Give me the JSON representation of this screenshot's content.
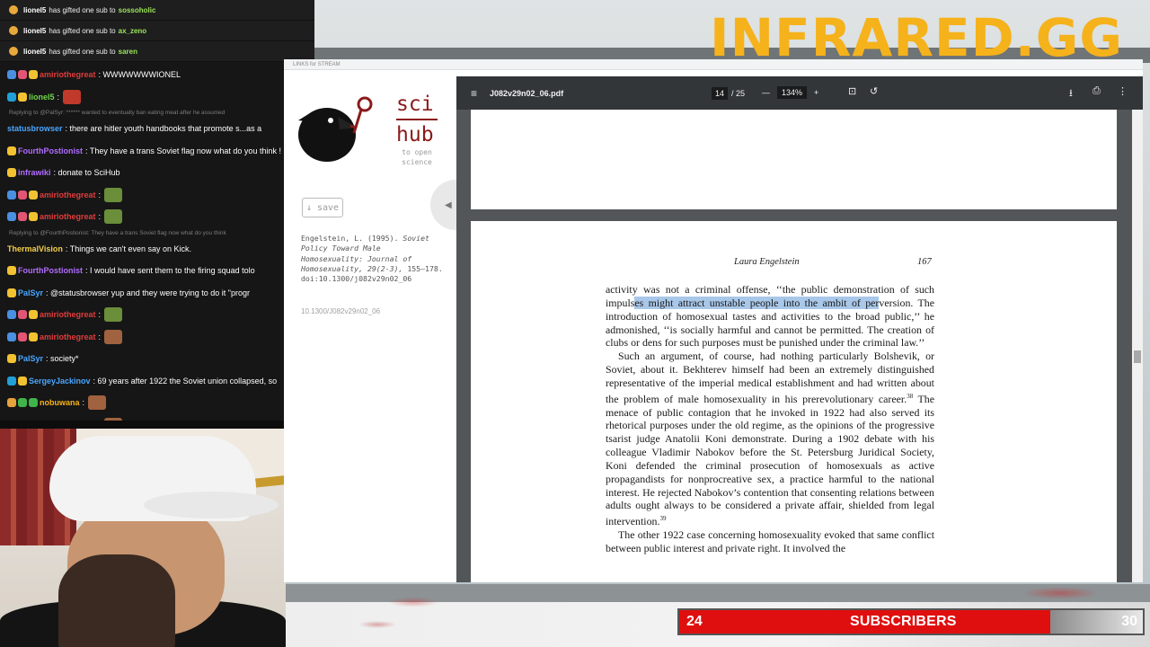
{
  "brand": "INFRARED.GG",
  "gift_subs": [
    {
      "gifter": "lionel5",
      "text": "has gifted one sub to",
      "recipient": "sossoholic"
    },
    {
      "gifter": "lionel5",
      "text": "has gifted one sub to",
      "recipient": "ax_zeno"
    },
    {
      "gifter": "lionel5",
      "text": "has gifted one sub to",
      "recipient": "saren"
    }
  ],
  "chat": [
    {
      "type": "msg",
      "user": "amiriothegreat",
      "user_color": "#e03c3c",
      "text": ": WWWWWWWIONEL",
      "badges": [
        "b-blue",
        "b-pink",
        "b-yel"
      ],
      "emote": ""
    },
    {
      "type": "msg",
      "user": "lionel5",
      "user_color": "#6fd64b",
      "text": ":",
      "badges": [
        "b-cyan",
        "b-yel"
      ],
      "emote": "red"
    },
    {
      "type": "reply",
      "text": "Replying to @PalSyr: ****** wanted to eventually ban eating meat after he assumed"
    },
    {
      "type": "msg",
      "user": "statusbrowser",
      "user_color": "#4aa6ff",
      "text": ": there are hitler youth handbooks that promote s...as a",
      "badges": [],
      "emote": ""
    },
    {
      "type": "msg",
      "user": "FourthPostionist",
      "user_color": "#b06cff",
      "text": ": They have a trans Soviet flag now what do you think !",
      "badges": [
        "b-yel"
      ],
      "emote": ""
    },
    {
      "type": "msg",
      "user": "infrawiki",
      "user_color": "#b06cff",
      "text": ": donate to SciHub",
      "badges": [
        "b-yel"
      ],
      "emote": ""
    },
    {
      "type": "msg",
      "user": "amiriothegreat",
      "user_color": "#e03c3c",
      "text": ":",
      "badges": [
        "b-blue",
        "b-pink",
        "b-yel"
      ],
      "emote": "green"
    },
    {
      "type": "msg",
      "user": "amiriothegreat",
      "user_color": "#e03c3c",
      "text": ":",
      "badges": [
        "b-blue",
        "b-pink",
        "b-yel"
      ],
      "emote": "green"
    },
    {
      "type": "reply",
      "text": "Replying to @FourthPostionist: They have a trans Soviet flag now what do you think"
    },
    {
      "type": "msg",
      "user": "ThermalVision",
      "user_color": "#f5d04a",
      "text": ": Things we can't even say on Kick.",
      "badges": [],
      "emote": ""
    },
    {
      "type": "msg",
      "user": "FourthPostionist",
      "user_color": "#b06cff",
      "text": ": I would have sent them to the firing squad tolo",
      "badges": [
        "b-yel"
      ],
      "emote": ""
    },
    {
      "type": "msg",
      "user": "PalSyr",
      "user_color": "#4aa6ff",
      "text": ": @statusbrowser yup and they were trying to do it \"progr",
      "badges": [
        "b-yel"
      ],
      "emote": ""
    },
    {
      "type": "msg",
      "user": "amiriothegreat",
      "user_color": "#e03c3c",
      "text": ":",
      "badges": [
        "b-blue",
        "b-pink",
        "b-yel"
      ],
      "emote": "green"
    },
    {
      "type": "msg",
      "user": "amiriothegreat",
      "user_color": "#e03c3c",
      "text": ":",
      "badges": [
        "b-blue",
        "b-pink",
        "b-yel"
      ],
      "emote": "face"
    },
    {
      "type": "msg",
      "user": "PalSyr",
      "user_color": "#4aa6ff",
      "text": ": society*",
      "badges": [
        "b-yel"
      ],
      "emote": ""
    },
    {
      "type": "msg",
      "user": "SergeyJackinov",
      "user_color": "#4aa6ff",
      "text": ": 69 years after 1922 the Soviet union collapsed, so",
      "badges": [
        "b-cyan",
        "b-yel"
      ],
      "emote": ""
    },
    {
      "type": "msg",
      "user": "nobuwana",
      "user_color": "#f5b21b",
      "text": ":",
      "badges": [
        "b-gold",
        "b-grn",
        "b-grn"
      ],
      "emote": "face"
    },
    {
      "type": "msg",
      "user": "amiriothegreat",
      "user_color": "#e03c3c",
      "text": ":",
      "badges": [
        "b-blue",
        "b-pink",
        "b-yel"
      ],
      "emote": "face"
    }
  ],
  "browser": {
    "tab_text": "LINKS for STREAM",
    "scihub": {
      "logo_line1": "sci",
      "logo_line2": "hub",
      "logo_sub": "to open science",
      "save_label": "↓ save",
      "citation_plain1": "Engelstein, L. (1995).",
      "citation_italic": "Soviet Policy Toward Male Homosexuality: Journal of Homosexuality, 29(2-3),",
      "citation_plain2": "155–178.",
      "citation_doi": "doi:10.1300/j082v29n02_06",
      "doi_short": "10.1300/J082v29n02_06",
      "collapse_icon": "◀"
    },
    "pdf": {
      "menu_icon": "≡",
      "filename": "J082v29n02_06.pdf",
      "page_current": "14",
      "page_total": "/ 25",
      "zoom": "134%",
      "minus": "—",
      "plus": "+",
      "fit_icon": "⊡",
      "rotate_icon": "↺",
      "download_icon": "⭳",
      "print_icon": "⎙",
      "more_icon": "⋮",
      "running_head": "Laura Engelstein",
      "page_number": "167",
      "p1_before": "activity was not a criminal offense, ‘‘the public demonstration of such impuls",
      "p1_highlight": "es might attract unstable people into the ambit of per",
      "p1_after": "version. The introduction of homosexual tastes and activities to the broad public,’’ he admonished, ‘‘is socially harmful and cannot be permitted. The creation of clubs or dens for such purposes must be punished under the criminal law.’’",
      "p2_a": "Such an argument, of course, had nothing particularly Bolshevik, or Soviet, about it. Bekhterev himself had been an extremely distinguished representative of the imperial medical establishment and had written about the problem of male homosexuality in his prerevolutionary career.",
      "p2_sup": "38",
      "p2_b": " The menace of public contagion that he invoked in 1922 had also served its rhetorical purposes under the old regime, as the opinions of the progressive tsarist judge Anatolii Koni demonstrate. During a 1902 debate with his colleague Vladimir Nabokov before the St. Petersburg Juridical Society, Koni defended the criminal prosecution of homosexuals as active propagandists for nonprocreative sex, a practice harmful to the national interest. He rejected Nabokov’s contention that consenting relations between adults ought always to be considered a private affair, shielded from legal intervention.",
      "p2_sup2": "39",
      "p3": "The other 1922 case concerning homosexuality evoked that same conflict between public interest and private right. It involved the"
    }
  },
  "subs": {
    "current": "24",
    "label": "SUBSCRIBERS",
    "goal": "30",
    "progress": 0.8
  }
}
